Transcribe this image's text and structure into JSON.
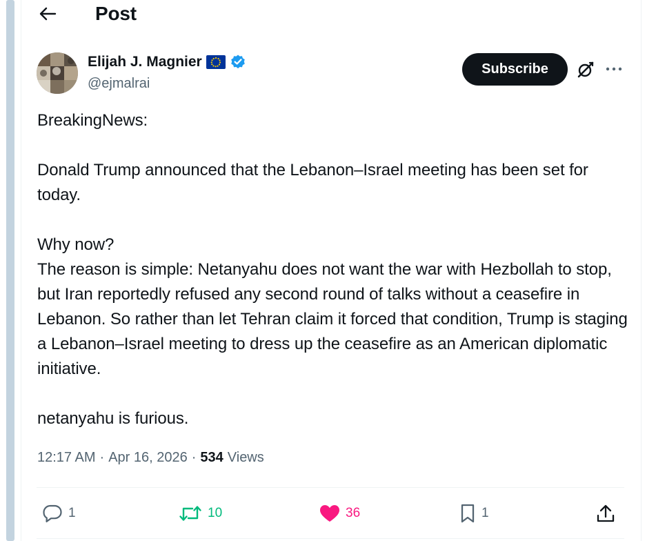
{
  "header": {
    "title": "Post",
    "back_icon": "arrow-left-icon"
  },
  "author": {
    "display_name": "Elijah J. Magnier",
    "handle": "@ejmalrai",
    "badges": [
      "eu-flag-icon",
      "verified-badge-icon"
    ],
    "verified_color": "#1d9bf0"
  },
  "actions_top": {
    "subscribe_label": "Subscribe",
    "grok_icon": "grok-icon",
    "more_icon": "more-icon"
  },
  "tweet": {
    "line1": "BreakingNews:",
    "para1": "Donald Trump announced that the Lebanon–Israel meeting has been set for today.",
    "para2_line1": "Why now?",
    "para2_body": "The reason is simple: Netanyahu does not want the war with Hezbollah to stop, but Iran reportedly refused any second round of talks without a ceasefire in Lebanon. So rather than let Tehran claim it forced that condition, Trump is staging a Lebanon–Israel meeting to dress up the ceasefire as an American diplomatic initiative.",
    "para3": "netanyahu is furious."
  },
  "meta": {
    "time": "12:17 AM",
    "date": "Apr 16, 2026",
    "separator": "·",
    "views_count": "534",
    "views_label": "Views"
  },
  "engagement": {
    "replies": "1",
    "reposts": "10",
    "likes": "36",
    "bookmarks": "1"
  },
  "colors": {
    "text_primary": "#0f1419",
    "text_secondary": "#536471",
    "repost_green": "#00ba7c",
    "like_pink": "#f91880"
  }
}
